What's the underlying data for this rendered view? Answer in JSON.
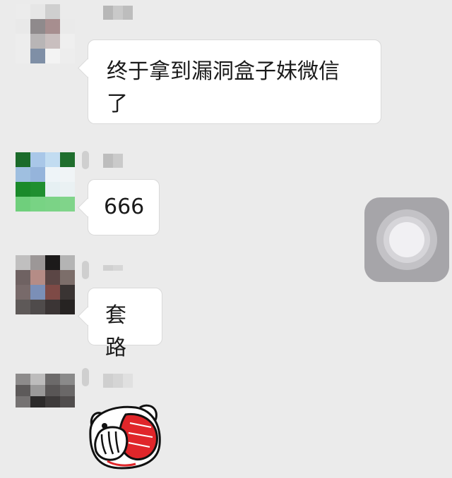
{
  "chat": {
    "messages": [
      {
        "text": "终于拿到漏洞盒子妹微信\n了"
      },
      {
        "text": "666"
      },
      {
        "text": "套路"
      }
    ]
  },
  "overlay": {
    "assistive_touch_icon": "assistive-touch-icon"
  },
  "sticker": {
    "icon": "face-palm-sticker"
  }
}
